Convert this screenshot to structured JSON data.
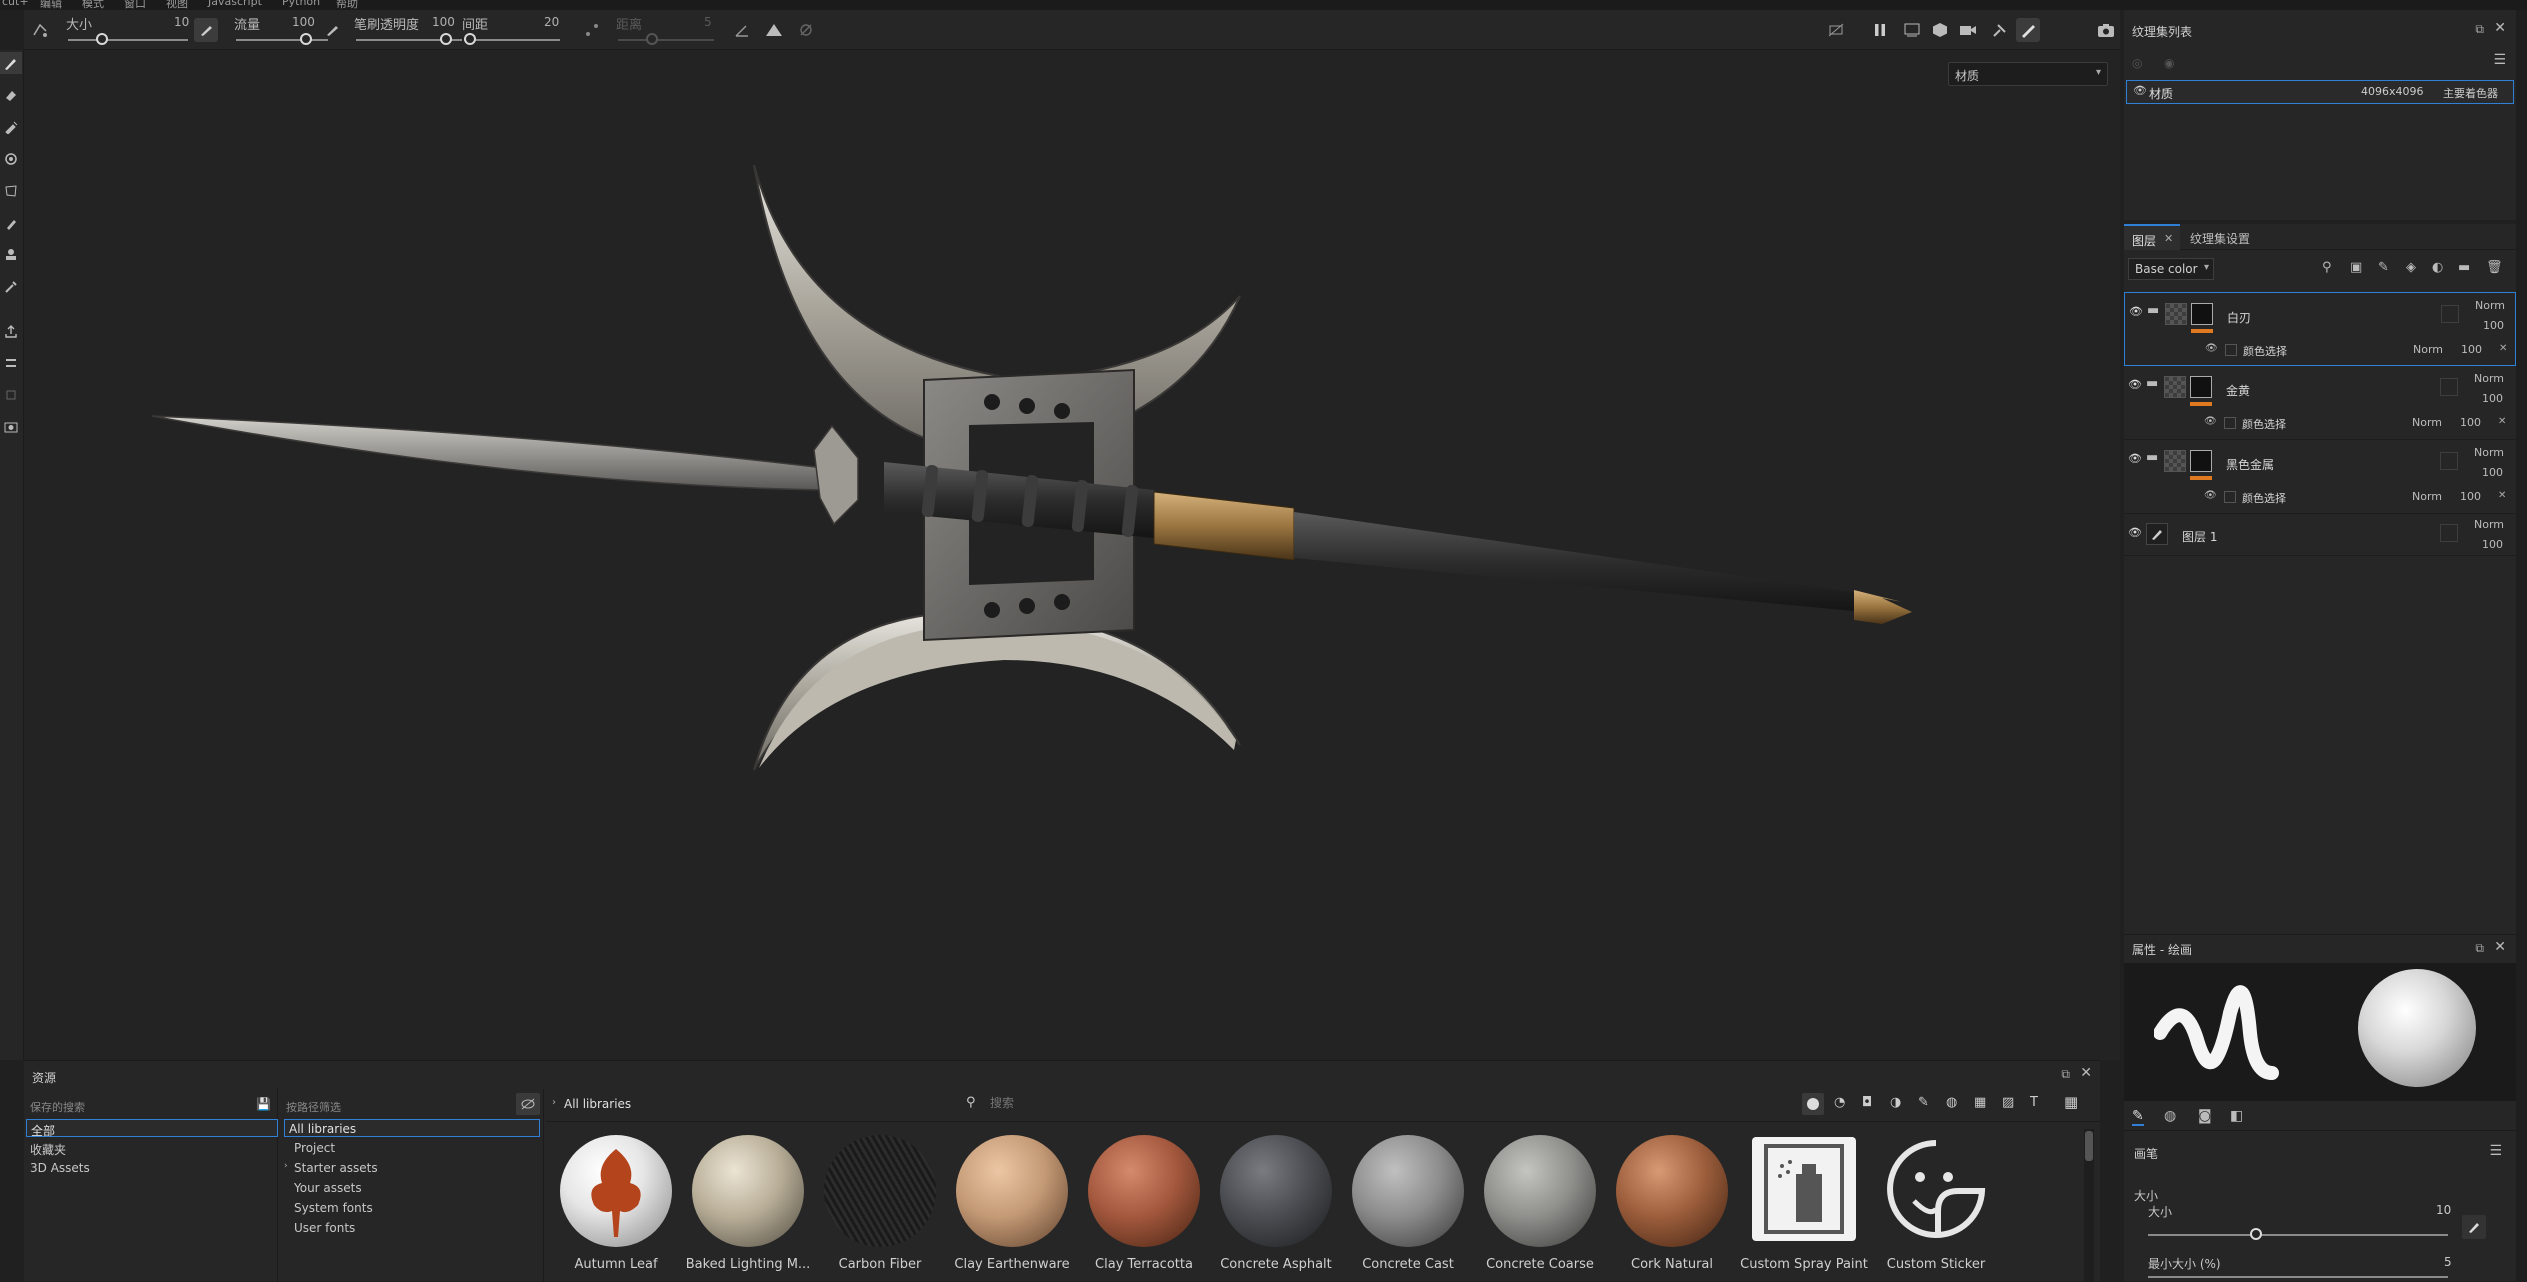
{
  "menu": [
    "cut+",
    "编辑",
    "模式",
    "窗口",
    "视图",
    "Javascript",
    "Python",
    "帮助"
  ],
  "toolbar": {
    "size_label": "大小",
    "size_value": "10",
    "flow_label": "流量",
    "flow_value": "100",
    "opacity_label": "笔刷透明度",
    "opacity_value": "100",
    "spacing_label": "间距",
    "spacing_value": "20",
    "distance_label": "距离",
    "distance_value": "5"
  },
  "viewport": {
    "material_select": "材质"
  },
  "texture_list": {
    "title": "纹理集列表",
    "row": {
      "name": "材质",
      "resolution": "4096x4096",
      "shader": "主要着色器"
    }
  },
  "layers_panel": {
    "tab_layers": "图层",
    "tab_settings": "纹理集设置",
    "channel": "Base color",
    "layers": [
      {
        "name": "白刃",
        "blend": "Norm",
        "opacity": "100",
        "sub": "颜色选择",
        "sub_blend": "Norm",
        "sub_opacity": "100"
      },
      {
        "name": "金黄",
        "blend": "Norm",
        "opacity": "100",
        "sub": "颜色选择",
        "sub_blend": "Norm",
        "sub_opacity": "100"
      },
      {
        "name": "黑色金属",
        "blend": "Norm",
        "opacity": "100",
        "sub": "颜色选择",
        "sub_blend": "Norm",
        "sub_opacity": "100"
      },
      {
        "name": "图层 1",
        "blend": "Norm",
        "opacity": "100"
      }
    ]
  },
  "properties": {
    "title": "属性 - 绘画",
    "section": "画笔",
    "size_label": "大小",
    "size_value": "10",
    "min_size_label": "最小大小 (%)",
    "min_size_value": "5"
  },
  "assets": {
    "title": "资源",
    "saved_search": "保存的搜索",
    "path_filter": "按路径筛选",
    "left_items": [
      "全部",
      "收藏夹",
      "3D Assets"
    ],
    "middle_items": [
      "All libraries",
      "Project",
      "Starter assets",
      "Your assets",
      "System fonts",
      "User fonts"
    ],
    "breadcrumb": "All libraries",
    "search_placeholder": "搜索",
    "materials": [
      {
        "name": "Autumn Leaf",
        "color": "#e8e8e8"
      },
      {
        "name": "Baked Lighting M...",
        "color": "#b8ae98"
      },
      {
        "name": "Carbon Fiber",
        "color": "#151515"
      },
      {
        "name": "Clay Earthenware",
        "color": "#c49a76"
      },
      {
        "name": "Clay Terracotta",
        "color": "#a4583e"
      },
      {
        "name": "Concrete Asphalt",
        "color": "#4c4d52"
      },
      {
        "name": "Concrete Cast",
        "color": "#8d8d8d"
      },
      {
        "name": "Concrete Coarse",
        "color": "#8f8f8c"
      },
      {
        "name": "Cork Natural",
        "color": "#9c5e3c"
      },
      {
        "name": "Custom Spray Paint",
        "color": "#e8e8e8"
      },
      {
        "name": "Custom Sticker",
        "color": "#e8e8e8"
      }
    ]
  }
}
